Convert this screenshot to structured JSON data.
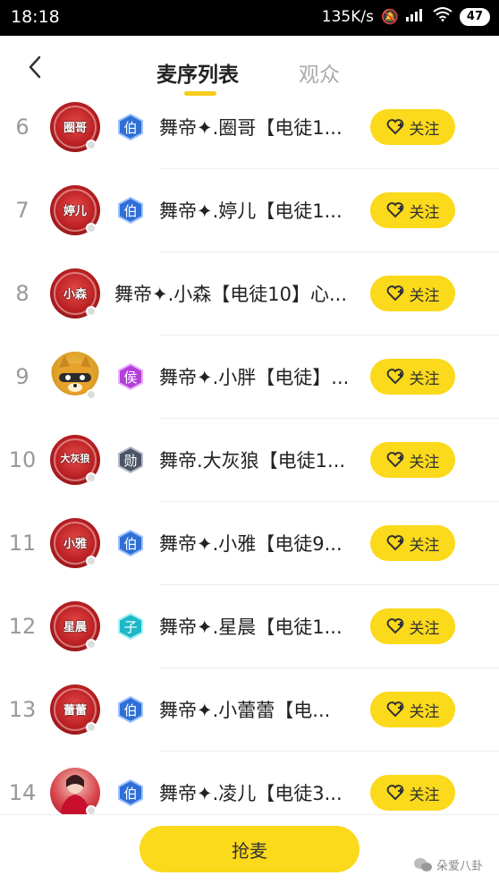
{
  "status_bar": {
    "time": "18:18",
    "speed": "135K/s",
    "battery": "47"
  },
  "header": {
    "tab_active": "麦序列表",
    "tab_inactive": "观众"
  },
  "colors": {
    "accent": "#fbd91b",
    "rank_text": "#999999"
  },
  "rows": [
    {
      "rank": "6",
      "badge": "伯",
      "badge_color": "#2f6fd6",
      "name": "舞帝✦.圈哥【电徒1...",
      "follow": "关注",
      "avatar_text": "圈哥"
    },
    {
      "rank": "7",
      "badge": "伯",
      "badge_color": "#2f6fd6",
      "name": "舞帝✦.婷儿【电徒1...",
      "follow": "关注",
      "avatar_text": "婷儿"
    },
    {
      "rank": "8",
      "badge": "",
      "badge_color": "",
      "name": "舞帝✦.小森【电徒10】心...",
      "follow": "关注",
      "avatar_text": "小森"
    },
    {
      "rank": "9",
      "badge": "侯",
      "badge_color": "#b43fd9",
      "name": "舞帝✦.小胖【电徒】...",
      "follow": "关注",
      "avatar_text": ""
    },
    {
      "rank": "10",
      "badge": "勋",
      "badge_color": "#4c5566",
      "name": "舞帝.大灰狼【电徒1...",
      "follow": "关注",
      "avatar_text": "大灰狼"
    },
    {
      "rank": "11",
      "badge": "伯",
      "badge_color": "#2f6fd6",
      "name": "舞帝✦.小雅【电徒9...",
      "follow": "关注",
      "avatar_text": "小雅"
    },
    {
      "rank": "12",
      "badge": "子",
      "badge_color": "#1fb8c8",
      "name": "舞帝✦.星晨【电徒1...",
      "follow": "关注",
      "avatar_text": "星晨"
    },
    {
      "rank": "13",
      "badge": "伯",
      "badge_color": "#2f6fd6",
      "name": "舞帝✦.小蕾蕾【电...",
      "follow": "关注",
      "avatar_text": "蕾蕾"
    },
    {
      "rank": "14",
      "badge": "伯",
      "badge_color": "#2f6fd6",
      "name": "舞帝✦.凌儿【电徒3...",
      "follow": "关注",
      "avatar_text": ""
    }
  ],
  "bottom": {
    "button": "抢麦",
    "watermark": "朵爱八卦"
  }
}
